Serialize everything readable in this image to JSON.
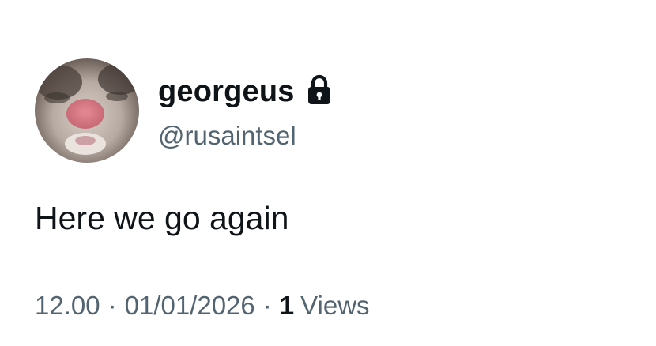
{
  "user": {
    "display_name": "georgeus",
    "handle": "@rusaintsel",
    "protected_icon": "lock-icon"
  },
  "tweet": {
    "text": "Here we go again"
  },
  "meta": {
    "time": "12.00",
    "separator": "·",
    "date": "01/01/2026",
    "views_count": "1",
    "views_label": "Views"
  },
  "colors": {
    "primary_text": "#0f1419",
    "secondary_text": "#536471",
    "background": "#ffffff"
  }
}
